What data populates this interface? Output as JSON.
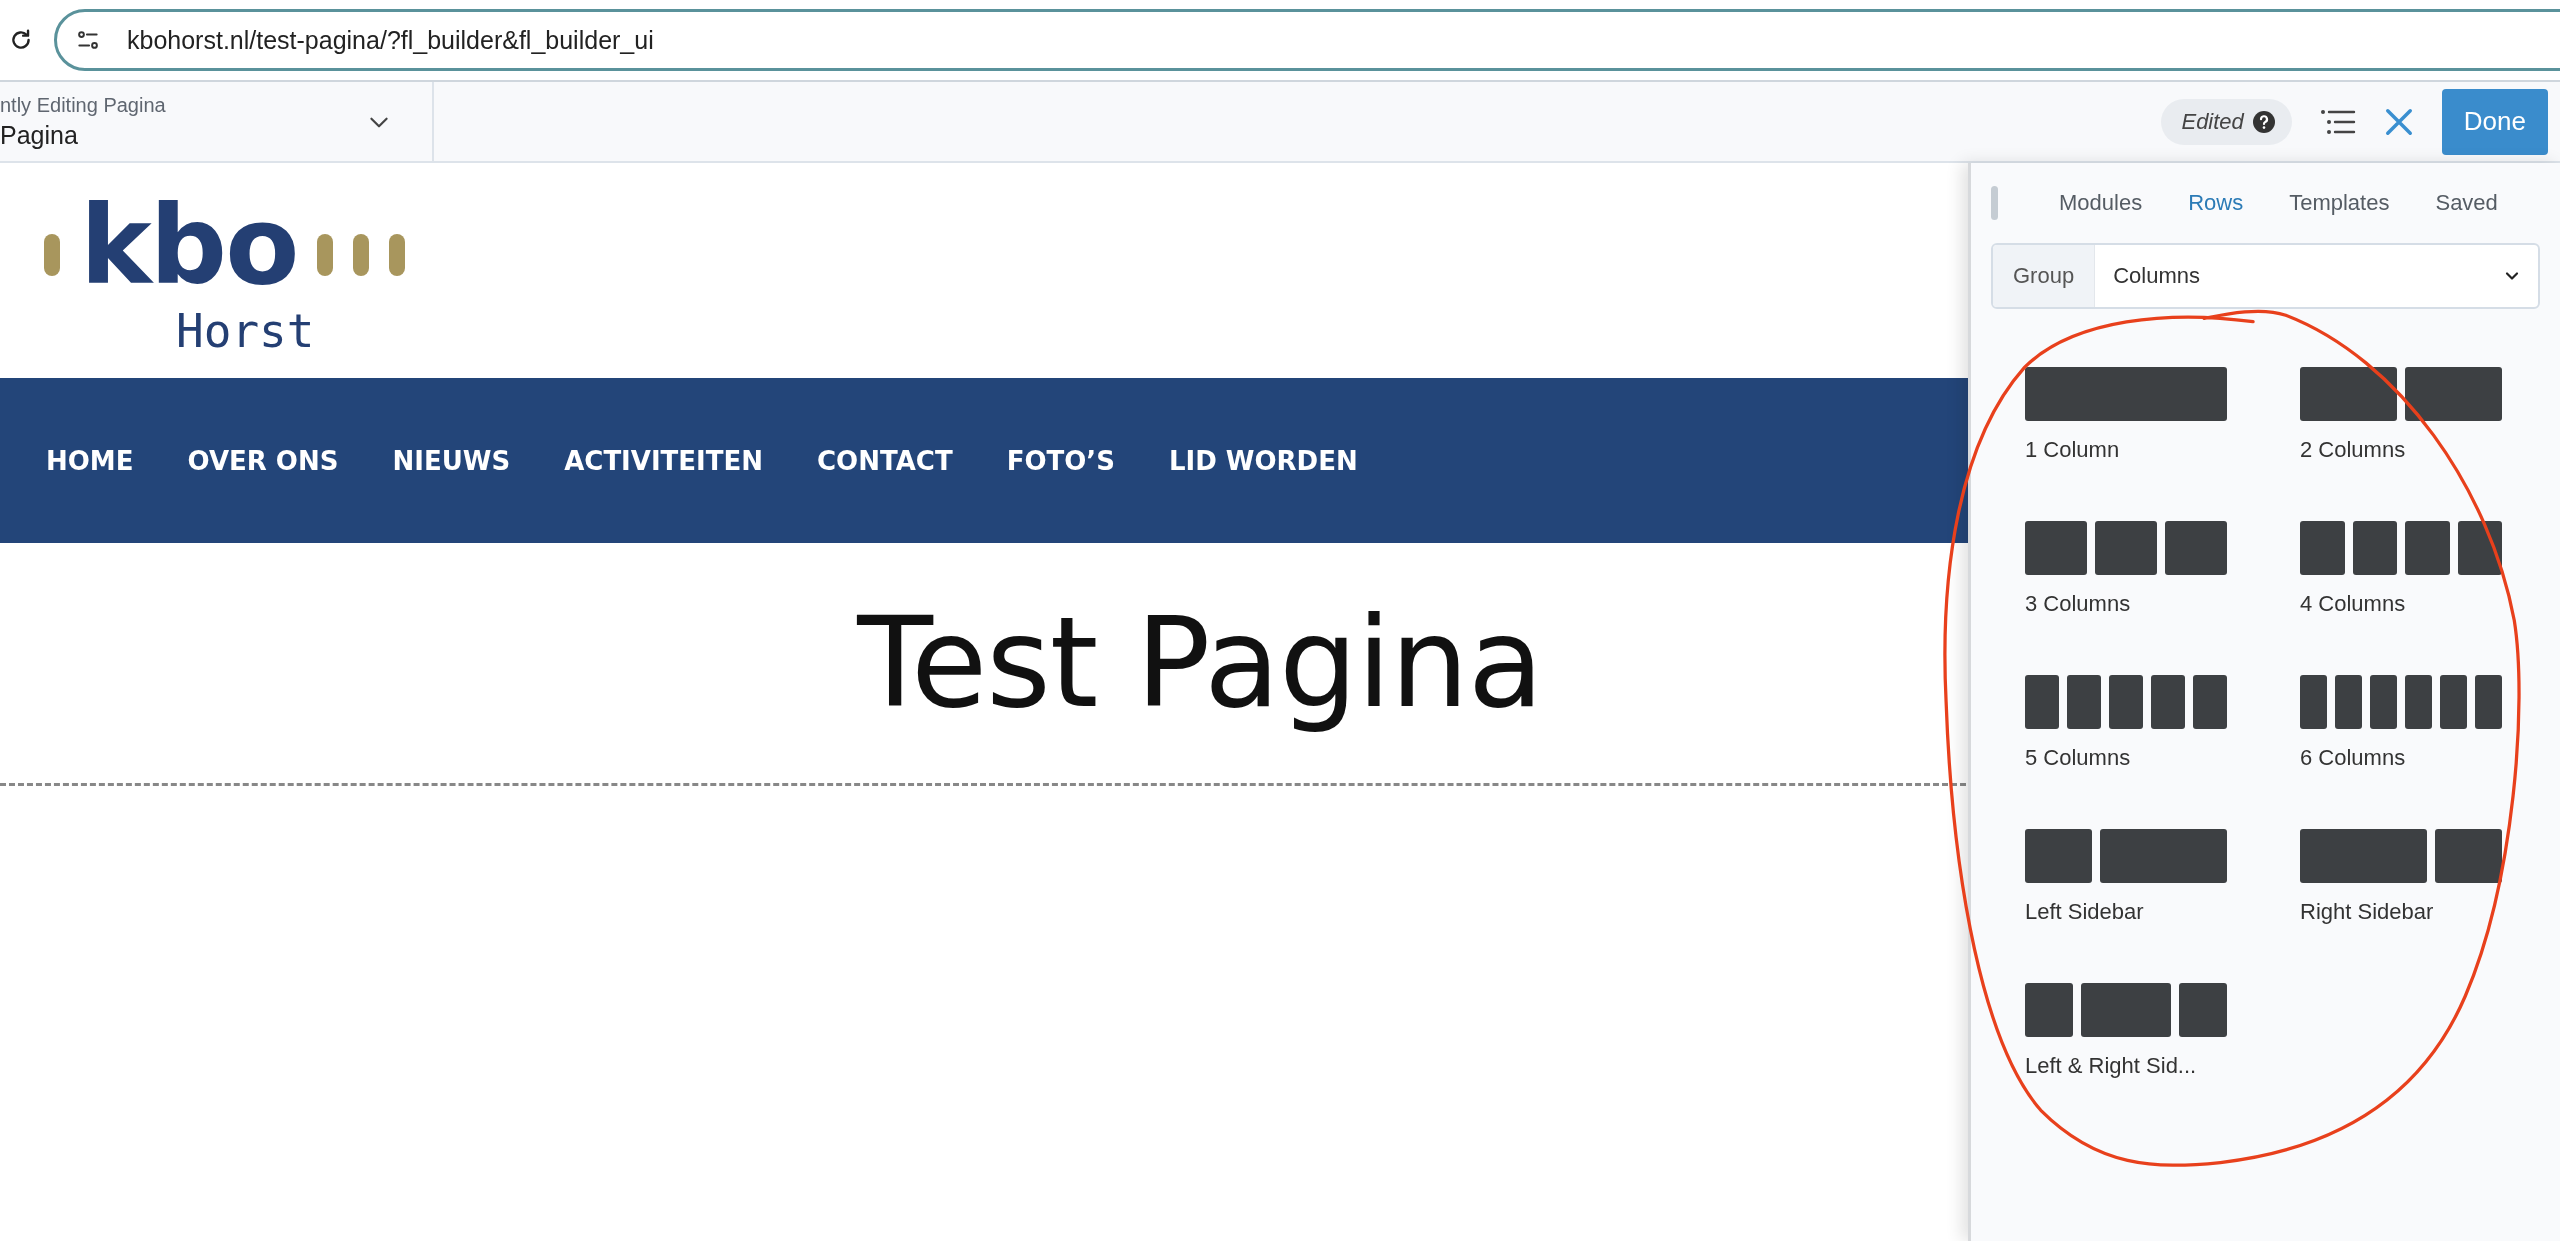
{
  "browser": {
    "url": "kbohorst.nl/test-pagina/?fl_builder&fl_builder_ui"
  },
  "builder_bar": {
    "editing_label": "ntly Editing Pagina",
    "page": "Pagina",
    "status": "Edited",
    "done_button": "Done"
  },
  "site": {
    "logo": {
      "mark": "kbo",
      "name": "Horst"
    },
    "nav": [
      "HOME",
      "OVER ONS",
      "NIEUWS",
      "ACTIVITEITEN",
      "CONTACT",
      "FOTO’S",
      "LID WORDEN"
    ],
    "title": "Test Pagina"
  },
  "panel": {
    "tabs": [
      {
        "label": "Modules",
        "selected": false
      },
      {
        "label": "Rows",
        "selected": true
      },
      {
        "label": "Templates",
        "selected": false
      },
      {
        "label": "Saved",
        "selected": false
      }
    ],
    "group": {
      "label": "Group",
      "value": "Columns"
    },
    "layouts": [
      {
        "label": "1 Column",
        "kind": "one"
      },
      {
        "label": "2 Columns",
        "kind": "two"
      },
      {
        "label": "3 Columns",
        "kind": "three"
      },
      {
        "label": "4 Columns",
        "kind": "four"
      },
      {
        "label": "5 Columns",
        "kind": "five"
      },
      {
        "label": "6 Columns",
        "kind": "six"
      },
      {
        "label": "Left Sidebar",
        "kind": "left-sidebar"
      },
      {
        "label": "Right Sidebar",
        "kind": "right-sidebar"
      },
      {
        "label": "Left & Right Sid...",
        "kind": "both-sidebars"
      }
    ]
  }
}
